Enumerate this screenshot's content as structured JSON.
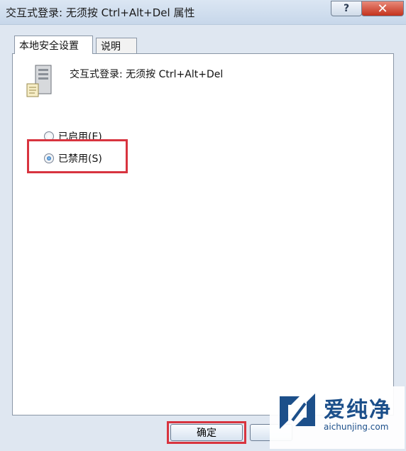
{
  "window": {
    "title": "交互式登录: 无须按 Ctrl+Alt+Del 属性",
    "help_label": "?",
    "close_label": "✕"
  },
  "tabs": [
    {
      "label": "本地安全设置"
    },
    {
      "label": "说明"
    }
  ],
  "policy": {
    "title": "交互式登录: 无须按 Ctrl+Alt+Del",
    "icon": "server-icon"
  },
  "options": [
    {
      "label": "已启用(E)",
      "checked": false
    },
    {
      "label": "已禁用(S)",
      "checked": true
    }
  ],
  "buttons": {
    "ok_label": "确定",
    "cancel_label": ""
  },
  "highlight_color": "#d8343f",
  "watermark": {
    "name": "爱纯净",
    "url": "aichunjing.com"
  }
}
